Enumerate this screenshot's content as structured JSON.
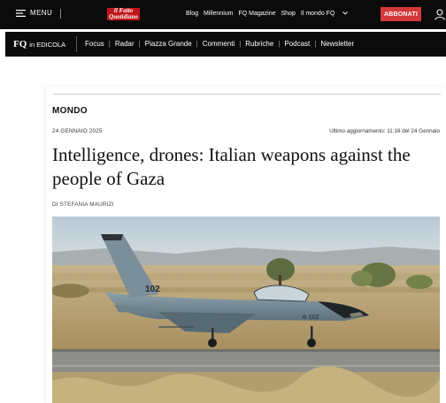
{
  "header": {
    "menu_label": "MENU",
    "logo_text": "il Fatto Quotidiano",
    "links": [
      "Blog",
      "Millennium",
      "FQ Magazine",
      "Shop",
      "Il mondo FQ"
    ],
    "subscribe_label": "ABBONATI"
  },
  "nav": {
    "edicola_mark": "FQ",
    "edicola_label": "in EDICOLA",
    "items": [
      "Focus",
      "Radar",
      "Piazza Grande",
      "Commenti",
      "Rubriche",
      "Podcast",
      "Newsletter"
    ]
  },
  "article": {
    "section": "MONDO",
    "date": "24 GENNAIO 2025",
    "updated": "Ultimo aggiornamento: 11:16 del 24 Gennaio",
    "headline": "Intelligence, drones: Italian weapons against the people of Gaza",
    "byline": "DI STEFANIA MAURIZI",
    "photo_tail_number": "102"
  },
  "colors": {
    "topbar": "#0b0b0b",
    "accent_red": "#d4383b",
    "logo_red": "#c0161b"
  }
}
